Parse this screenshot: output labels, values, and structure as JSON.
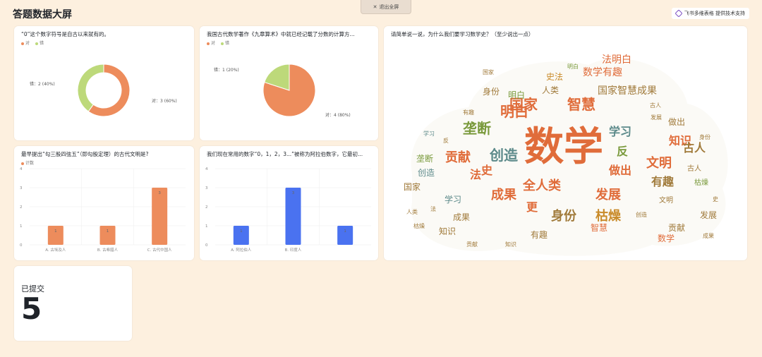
{
  "page": {
    "title": "答题数据大屏",
    "exit_label": "退出全屏",
    "brand_label": "飞书多维表格 提供技术支持"
  },
  "charts": {
    "q1": {
      "title": "“0”这个数字符号是自古以来就有的。",
      "legend": [
        {
          "name": "对",
          "color": "#ed8c5c"
        },
        {
          "name": "错",
          "color": "#bdd97a"
        }
      ],
      "label_a": "对：3 (60%)",
      "label_b": "错：2 (40%)"
    },
    "q2": {
      "title": "我国古代数学著作《九章算术》中就已经记载了分数的计算方...",
      "legend": [
        {
          "name": "对",
          "color": "#ed8c5c"
        },
        {
          "name": "错",
          "color": "#bdd97a"
        }
      ],
      "label_a": "对：4 (80%)",
      "label_b": "错：1 (20%)"
    },
    "q3": {
      "title": "最早提出“勾三股四弦五”（即勾股定理）的古代文明是?",
      "legend_name": "计数",
      "yticks": [
        "0",
        "1",
        "2",
        "3",
        "4"
      ],
      "bars": [
        {
          "category": "A. 古埃及人",
          "value_label": "1"
        },
        {
          "category": "B. 古希腊人",
          "value_label": "1"
        },
        {
          "category": "C. 古代中国人",
          "value_label": "3"
        }
      ]
    },
    "q4": {
      "title": "我们现在常用的数字“0，1，2，3...”被称为阿拉伯数字，它最初...",
      "yticks": [
        "0",
        "1",
        "2",
        "3",
        "4"
      ],
      "bars": [
        {
          "category": "A. 阿拉伯人",
          "value_label": "1"
        },
        {
          "category": "B. 印度人",
          "value_label": "3"
        },
        {
          "category": "",
          "value_label": "1"
        }
      ]
    },
    "q5": {
      "title": "请简单说一说，为什么我们要学习数学史？（至少说出一点）"
    }
  },
  "submitted": {
    "label": "已提交",
    "count": "5"
  },
  "chart_data": [
    {
      "type": "pie",
      "title": "“0”这个数字符号是自古以来就有的。",
      "categories": [
        "对",
        "错"
      ],
      "values": [
        3,
        2
      ],
      "percent": [
        60,
        40
      ],
      "donut": true,
      "colors": [
        "#ed8c5c",
        "#bdd97a"
      ]
    },
    {
      "type": "pie",
      "title": "我国古代数学著作《九章算术》中就已经记载了分数的计算方...",
      "categories": [
        "对",
        "错"
      ],
      "values": [
        4,
        1
      ],
      "percent": [
        80,
        20
      ],
      "donut": false,
      "colors": [
        "#ed8c5c",
        "#bdd97a"
      ]
    },
    {
      "type": "bar",
      "title": "最早提出“勾三股四弦五”（即勾股定理）的古代文明是?",
      "categories": [
        "A. 古埃及人",
        "B. 古希腊人",
        "C. 古代中国人"
      ],
      "series": [
        {
          "name": "计数",
          "values": [
            1,
            1,
            3
          ]
        }
      ],
      "ylim": [
        0,
        4
      ],
      "grid": true,
      "color": "#ed8c5c"
    },
    {
      "type": "bar",
      "title": "我们现在常用的数字“0，1，2，3...”被称为阿拉伯数字，它最初...",
      "categories": [
        "A. 阿拉伯人",
        "B. 印度人",
        ""
      ],
      "series": [
        {
          "values": [
            1,
            3,
            1
          ]
        }
      ],
      "ylim": [
        0,
        4
      ],
      "grid": true,
      "color": "#4a72f0"
    }
  ],
  "wordcloud": {
    "palette": [
      "#e06c3a",
      "#7a9a3c",
      "#a07a3a",
      "#5c8a8a",
      "#c98b2a",
      "#b05a40",
      "#6f7f4f",
      "#d9a05b"
    ],
    "words": [
      {
        "text": "数学",
        "size": 56,
        "color": "#e06c3a"
      },
      {
        "text": "国家",
        "size": 20,
        "color": "#e06c3a"
      },
      {
        "text": "智慧",
        "size": 20,
        "color": "#e06c3a"
      },
      {
        "text": "明白",
        "size": 20,
        "color": "#e06c3a"
      },
      {
        "text": "垄断",
        "size": 20,
        "color": "#7a9a3c"
      },
      {
        "text": "创造",
        "size": 20,
        "color": "#5c8a8a"
      },
      {
        "text": "贡献",
        "size": 18,
        "color": "#e06c3a"
      },
      {
        "text": "成果",
        "size": 18,
        "color": "#e06c3a"
      },
      {
        "text": "发展",
        "size": 18,
        "color": "#e06c3a"
      },
      {
        "text": "全人类",
        "size": 18,
        "color": "#e06c3a"
      },
      {
        "text": "身份",
        "size": 18,
        "color": "#a07a3a"
      },
      {
        "text": "枯燥",
        "size": 18,
        "color": "#c98b2a"
      },
      {
        "text": "文明",
        "size": 18,
        "color": "#e06c3a"
      },
      {
        "text": "知识",
        "size": 16,
        "color": "#e06c3a"
      },
      {
        "text": "学习",
        "size": 16,
        "color": "#5c8a8a"
      },
      {
        "text": "有趣",
        "size": 16,
        "color": "#a07a3a"
      },
      {
        "text": "古人",
        "size": 16,
        "color": "#a07a3a"
      },
      {
        "text": "做出",
        "size": 16,
        "color": "#e06c3a"
      },
      {
        "text": "史",
        "size": 16,
        "color": "#e06c3a"
      },
      {
        "text": "法",
        "size": 16,
        "color": "#e06c3a"
      },
      {
        "text": "反",
        "size": 16,
        "color": "#7a9a3c"
      },
      {
        "text": "更",
        "size": 16,
        "color": "#e06c3a"
      },
      {
        "text": "数学有趣",
        "size": 14,
        "color": "#e06c3a"
      },
      {
        "text": "法明白",
        "size": 14,
        "color": "#e06c3a"
      },
      {
        "text": "国家智慧成果",
        "size": 14,
        "color": "#a07a3a"
      },
      {
        "text": "人类",
        "size": 12,
        "color": "#a07a3a"
      },
      {
        "text": "史法",
        "size": 12,
        "color": "#c98b2a"
      },
      {
        "text": "身份",
        "size": 12,
        "color": "#a07a3a"
      },
      {
        "text": "明白",
        "size": 12,
        "color": "#7a9a3c"
      },
      {
        "text": "创造",
        "size": 12,
        "color": "#5c8a8a"
      },
      {
        "text": "垄断",
        "size": 12,
        "color": "#7a9a3c"
      },
      {
        "text": "有趣",
        "size": 12,
        "color": "#a07a3a"
      },
      {
        "text": "发展",
        "size": 12,
        "color": "#a07a3a"
      },
      {
        "text": "学习",
        "size": 12,
        "color": "#5c8a8a"
      },
      {
        "text": "国家",
        "size": 12,
        "color": "#a07a3a"
      },
      {
        "text": "贡献",
        "size": 12,
        "color": "#a07a3a"
      },
      {
        "text": "智慧",
        "size": 12,
        "color": "#e06c3a"
      },
      {
        "text": "成果",
        "size": 12,
        "color": "#a07a3a"
      },
      {
        "text": "知识",
        "size": 12,
        "color": "#a07a3a"
      },
      {
        "text": "数学",
        "size": 12,
        "color": "#e06c3a"
      },
      {
        "text": "做出",
        "size": 12,
        "color": "#a07a3a"
      },
      {
        "text": "古人",
        "size": 10,
        "color": "#a07a3a"
      },
      {
        "text": "枯燥",
        "size": 10,
        "color": "#7a9a3c"
      },
      {
        "text": "文明",
        "size": 10,
        "color": "#a07a3a"
      },
      {
        "text": "身份",
        "size": 8,
        "color": "#a07a3a"
      },
      {
        "text": "有趣",
        "size": 8,
        "color": "#a07a3a"
      },
      {
        "text": "国家",
        "size": 8,
        "color": "#a07a3a"
      },
      {
        "text": "明白",
        "size": 8,
        "color": "#7a9a3c"
      },
      {
        "text": "学习",
        "size": 8,
        "color": "#5c8a8a"
      },
      {
        "text": "史",
        "size": 8,
        "color": "#a07a3a"
      },
      {
        "text": "反",
        "size": 8,
        "color": "#a07a3a"
      },
      {
        "text": "法",
        "size": 8,
        "color": "#a07a3a"
      },
      {
        "text": "发展",
        "size": 8,
        "color": "#a07a3a"
      },
      {
        "text": "创造",
        "size": 8,
        "color": "#a07a3a"
      },
      {
        "text": "人类",
        "size": 8,
        "color": "#a07a3a"
      },
      {
        "text": "成果",
        "size": 8,
        "color": "#a07a3a"
      },
      {
        "text": "贡献",
        "size": 8,
        "color": "#a07a3a"
      },
      {
        "text": "知识",
        "size": 8,
        "color": "#a07a3a"
      },
      {
        "text": "枯燥",
        "size": 8,
        "color": "#a07a3a"
      },
      {
        "text": "古人",
        "size": 8,
        "color": "#a07a3a"
      }
    ]
  }
}
